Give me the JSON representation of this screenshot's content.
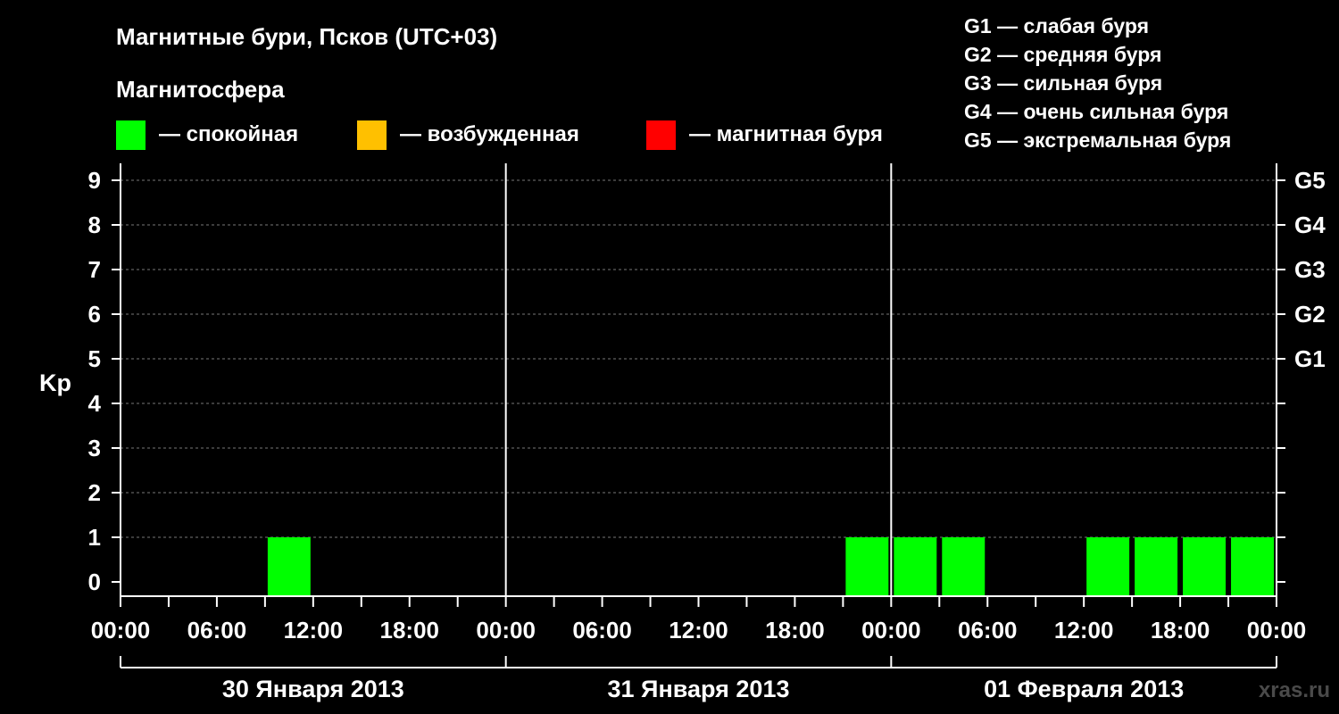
{
  "title": "Магнитные бури, Псков (UTC+03)",
  "legend": {
    "heading": "Магнитосфера",
    "items": [
      {
        "label": "— спокойная",
        "color": "#00ff00"
      },
      {
        "label": "— возбужденная",
        "color": "#ffc000"
      },
      {
        "label": "— магнитная буря",
        "color": "#ff0000"
      }
    ]
  },
  "storm_scale": [
    "G1 — слабая буря",
    "G2 — средняя буря",
    "G3 — сильная буря",
    "G4 — очень сильная буря",
    "G5 — экстремальная буря"
  ],
  "watermark": "xras.ru",
  "chart_data": {
    "type": "bar",
    "ylabel": "Kp",
    "ylim": [
      0,
      9
    ],
    "yticks": [
      0,
      1,
      2,
      3,
      4,
      5,
      6,
      7,
      8,
      9
    ],
    "right_ticks": [
      {
        "kp": 5,
        "label": "G1"
      },
      {
        "kp": 6,
        "label": "G2"
      },
      {
        "kp": 7,
        "label": "G3"
      },
      {
        "kp": 8,
        "label": "G4"
      },
      {
        "kp": 9,
        "label": "G5"
      }
    ],
    "x_tick_labels": [
      "00:00",
      "06:00",
      "12:00",
      "18:00",
      "00:00",
      "06:00",
      "12:00",
      "18:00",
      "00:00",
      "06:00",
      "12:00",
      "18:00",
      "00:00"
    ],
    "days": [
      "30 Января 2013",
      "31 Января 2013",
      "01 Февраля 2013"
    ],
    "interval_hours": 3,
    "bar_color": "#00ff00",
    "series": [
      {
        "values": [
          null,
          null,
          null,
          1,
          null,
          null,
          null,
          null,
          null,
          null,
          null,
          null,
          null,
          null,
          null,
          1,
          1,
          1,
          null,
          null,
          1,
          1,
          1,
          1
        ]
      }
    ]
  }
}
